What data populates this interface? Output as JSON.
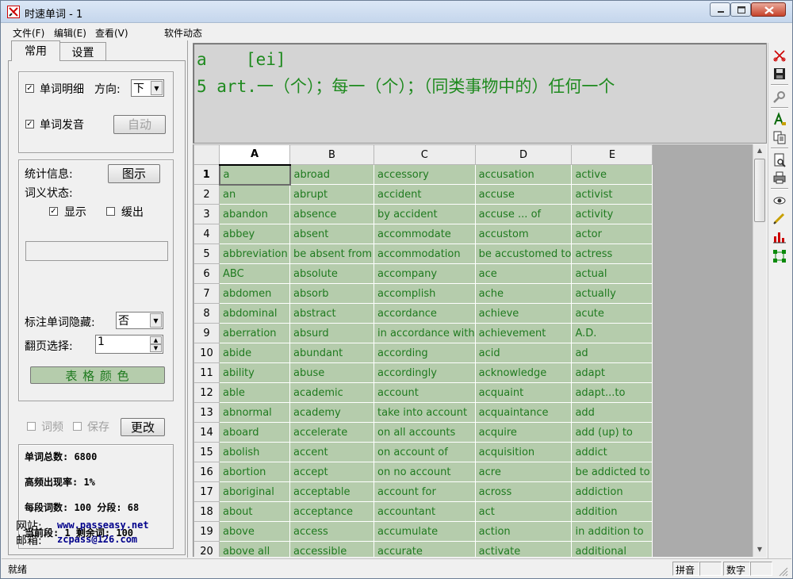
{
  "window": {
    "title": "时速单词 - 1"
  },
  "menu": {
    "file": "文件(F)",
    "edit": "编辑(E)",
    "view": "查看(V)",
    "news": "软件动态"
  },
  "tabs": {
    "common": "常用",
    "settings": "设置"
  },
  "options": {
    "detail_label": "单词明细",
    "direction_label": "方向:",
    "direction_value": "下",
    "pronounce_label": "单词发音",
    "auto_button": "自动",
    "stats_label": "统计信息:",
    "chart_button": "图示",
    "meaning_status_label": "词义状态:",
    "show_label": "显示",
    "slow_label": "缓出",
    "hide_label": "标注单词隐藏:",
    "hide_value": "否",
    "page_label": "翻页选择:",
    "page_value": "1",
    "color_button": "表 格 颜 色",
    "freq_label": "词频",
    "save_label": "保存",
    "change_button": "更改"
  },
  "stats": {
    "total": "单词总数: 6800",
    "high_freq": "高频出现率: 1%",
    "per_segment": "每段词数: 100 分段: 68",
    "current": "当前段: 1 剩余词: 100"
  },
  "contact": {
    "site_label": "网站:",
    "site": "www.passeasy.net",
    "email_label": "邮箱:",
    "email": "zcpass@126.com"
  },
  "display": {
    "word": "a",
    "phonetic": "[ei]",
    "definition": "5 art.一（个）；每一（个）；（同类事物中的）任何一个"
  },
  "grid": {
    "columns": [
      "A",
      "B",
      "C",
      "D",
      "E"
    ],
    "rows": [
      [
        "1",
        "a",
        "abroad",
        "accessory",
        "accusation",
        "active"
      ],
      [
        "2",
        "an",
        "abrupt",
        "accident",
        "accuse",
        "activist"
      ],
      [
        "3",
        "abandon",
        "absence",
        "by accident",
        "accuse ... of",
        "activity"
      ],
      [
        "4",
        "abbey",
        "absent",
        "accommodate",
        "accustom",
        "actor"
      ],
      [
        "5",
        "abbreviation",
        "be absent from",
        "accommodation",
        "be accustomed to",
        "actress"
      ],
      [
        "6",
        "ABC",
        "absolute",
        "accompany",
        "ace",
        "actual"
      ],
      [
        "7",
        "abdomen",
        "absorb",
        "accomplish",
        "ache",
        "actually"
      ],
      [
        "8",
        "abdominal",
        "abstract",
        "accordance",
        "achieve",
        "acute"
      ],
      [
        "9",
        "aberration",
        "absurd",
        "in accordance with",
        "achievement",
        "A.D."
      ],
      [
        "10",
        "abide",
        "abundant",
        "according",
        "acid",
        "ad"
      ],
      [
        "11",
        "ability",
        "abuse",
        "accordingly",
        "acknowledge",
        "adapt"
      ],
      [
        "12",
        "able",
        "academic",
        "account",
        "acquaint",
        "adapt...to"
      ],
      [
        "13",
        "abnormal",
        "academy",
        "take into account",
        "acquaintance",
        "add"
      ],
      [
        "14",
        "aboard",
        "accelerate",
        "on all accounts",
        "acquire",
        "add (up) to"
      ],
      [
        "15",
        "abolish",
        "accent",
        "on account of",
        "acquisition",
        "addict"
      ],
      [
        "16",
        "abortion",
        "accept",
        "on no account",
        "acre",
        "be addicted to"
      ],
      [
        "17",
        "aboriginal",
        "acceptable",
        "account for",
        "across",
        "addiction"
      ],
      [
        "18",
        "about",
        "acceptance",
        "accountant",
        "act",
        "addition"
      ],
      [
        "19",
        "above",
        "access",
        "accumulate",
        "action",
        "in addition to"
      ],
      [
        "20",
        "above all",
        "accessible",
        "accurate",
        "activate",
        "additional"
      ]
    ]
  },
  "status": {
    "ready": "就绪",
    "pinyin": "拼音",
    "numeric": "数字"
  },
  "colors": {
    "cell_bg": "#b5ccac",
    "cell_text": "#1f7a1f",
    "display_text": "#1e8a1e",
    "contact_text": "#00008b"
  }
}
